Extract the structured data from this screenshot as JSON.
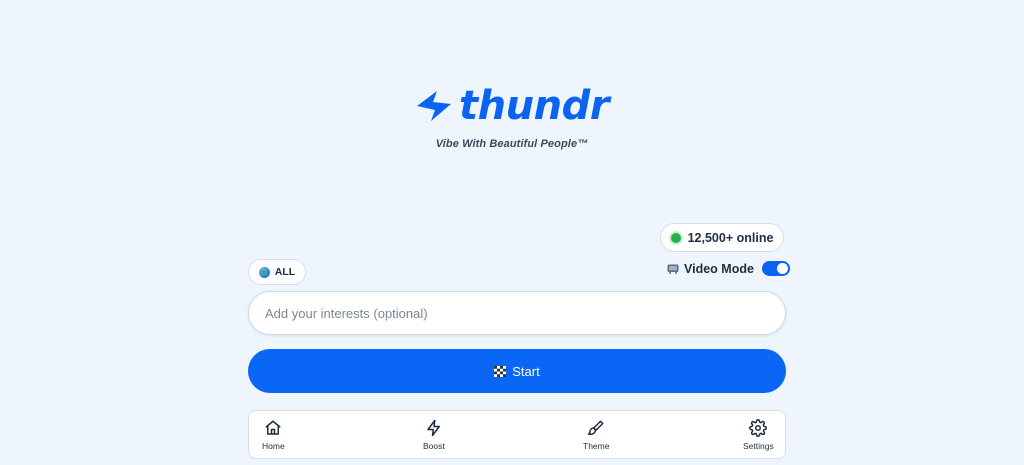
{
  "brand": {
    "name": "thundr",
    "tagline": "Vibe With Beautiful People™",
    "color": "#0b63f0"
  },
  "status": {
    "online_text": "12,500+ online",
    "dot_color": "#22b24c"
  },
  "filters": {
    "region_label": "ALL",
    "region_icon": "globe-icon",
    "video_mode_label": "Video Mode",
    "video_mode_icon": "tv-icon",
    "video_mode_enabled": true
  },
  "interests": {
    "value": "",
    "placeholder": "Add your interests (optional)"
  },
  "start": {
    "label": "Start",
    "icon": "checkered-flag-icon",
    "color": "#0a66f5"
  },
  "nav": {
    "items": [
      {
        "label": "Home",
        "icon": "home-icon"
      },
      {
        "label": "Boost",
        "icon": "lightning-icon"
      },
      {
        "label": "Theme",
        "icon": "paintbrush-icon"
      },
      {
        "label": "Settings",
        "icon": "gear-icon"
      }
    ]
  }
}
